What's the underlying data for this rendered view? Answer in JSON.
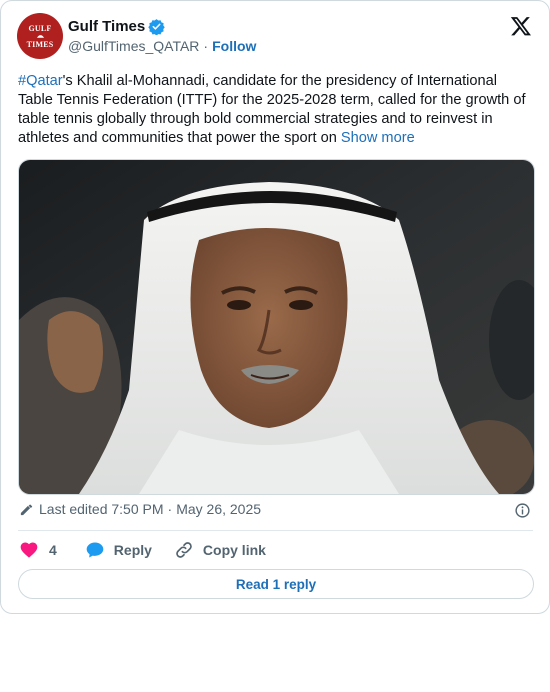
{
  "account": {
    "name": "Gulf Times",
    "handle": "@GulfTimes_QATAR",
    "separator": "·",
    "follow_label": "Follow",
    "avatar_line1": "GULF",
    "avatar_line2": "TIMES",
    "verified": true
  },
  "header": {
    "logo_icon": "x-logo-icon"
  },
  "post": {
    "hashtag": "#Qatar",
    "text": "'s Khalil al-Mohannadi, candidate for the presidency of International Table Tennis Federation (ITTF) for the 2025-2028 term, called for the growth of table tennis globally through bold commercial strategies and to reinvest in athletes and communities that power the sport on ",
    "show_more": "Show more",
    "image_icon": "photo-of-man-in-white-ghutra"
  },
  "meta": {
    "edited_label": "Last edited 7:50 PM",
    "separator": "·",
    "date": "May 26, 2025"
  },
  "actions": {
    "like_count": "4",
    "reply_label": "Reply",
    "copy_label": "Copy link"
  },
  "footer": {
    "read_reply_label": "Read 1 reply"
  },
  "colors": {
    "link": "#1d6fb8",
    "secondary_text": "#536471",
    "heart": "#f91880",
    "verified": "#1d9bf0",
    "avatar_bg": "#b0201f"
  }
}
